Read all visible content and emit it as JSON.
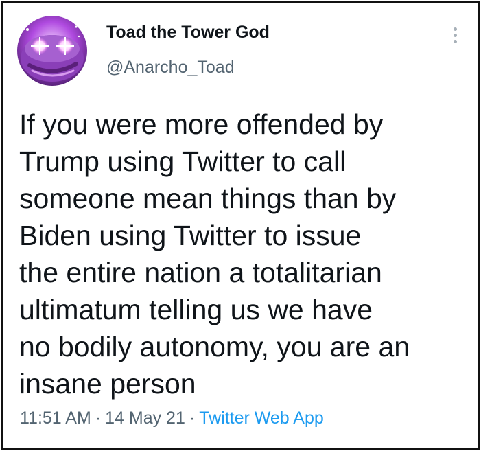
{
  "tweet": {
    "author": {
      "display_name": "Toad the Tower God",
      "handle": "@Anarcho_Toad",
      "avatar_icon": "pepe-frog-avatar-icon"
    },
    "more_icon": "more-options-icon",
    "text": "If you were more offended by\nTrump using Twitter to call\nsomeone mean things than by\nBiden using Twitter to issue\nthe entire nation a totalitarian\nultimatum telling us we have\nno bodily autonomy, you are an\ninsane person",
    "time": "11:51 AM",
    "date": "14 May 21",
    "separator": "·",
    "source": "Twitter Web App"
  },
  "colors": {
    "text_primary": "#0f1419",
    "text_secondary": "#536471",
    "link": "#1d9bf0",
    "border": "#111111"
  }
}
